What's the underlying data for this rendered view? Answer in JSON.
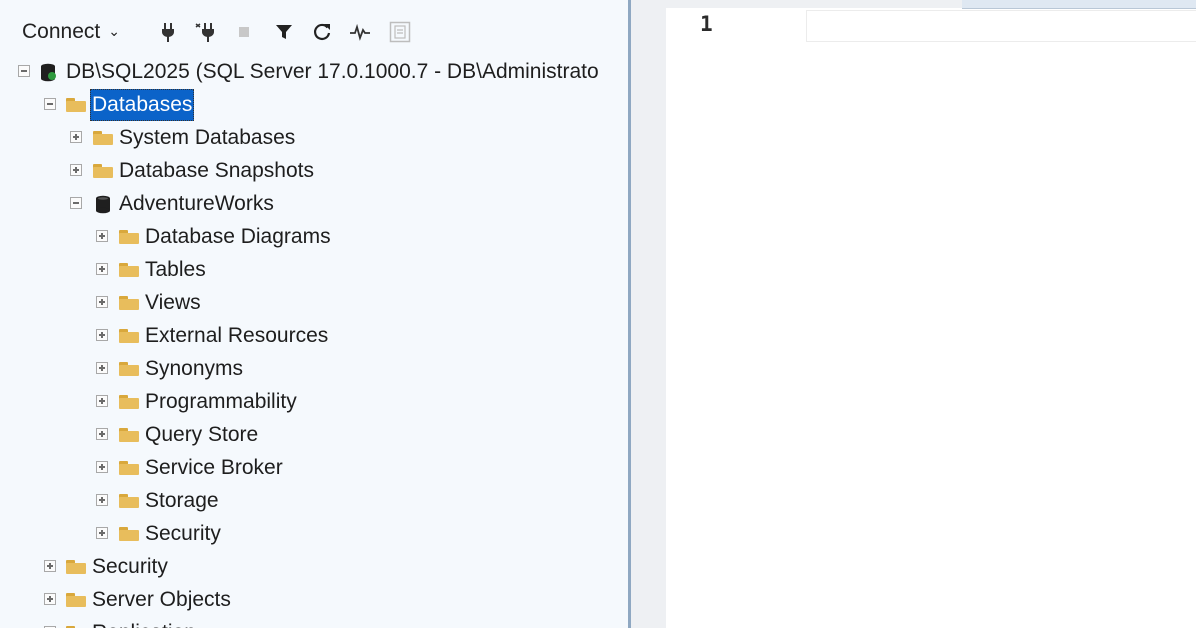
{
  "toolbar": {
    "connect_label": "Connect",
    "connect_chevron": "⌄",
    "icons": [
      "connect-plug-icon",
      "disconnect-plug-icon",
      "stop-icon",
      "filter-icon",
      "refresh-icon",
      "activity-monitor-icon",
      "script-icon"
    ]
  },
  "tree": {
    "server": "DB\\SQL2025 (SQL Server 17.0.1000.7 - DB\\Administrato",
    "databases": "Databases",
    "system_databases": "System Databases",
    "database_snapshots": "Database Snapshots",
    "adventureworks": {
      "name": "AdventureWorks",
      "children": [
        "Database Diagrams",
        "Tables",
        "Views",
        "External Resources",
        "Synonyms",
        "Programmability",
        "Query Store",
        "Service Broker",
        "Storage",
        "Security"
      ]
    },
    "server_security": "Security",
    "server_objects": "Server Objects",
    "replication": "Replication"
  },
  "editor": {
    "line_number": "1"
  },
  "colors": {
    "selection": "#0b63c9",
    "folder": "#e8bd5c",
    "pane_bg": "#f5f9fd"
  }
}
